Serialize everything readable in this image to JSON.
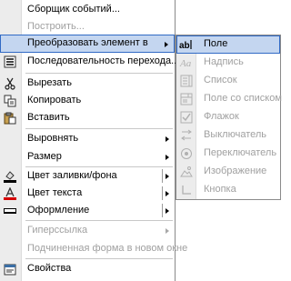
{
  "menu": {
    "items": [
      {
        "label": "Сборщик событий...",
        "icon": "none",
        "disabled": false,
        "submenu": false
      },
      {
        "label": "Построить...",
        "icon": "none",
        "disabled": true,
        "submenu": false
      },
      {
        "label": "Преобразовать элемент в",
        "icon": "none",
        "disabled": false,
        "submenu": true,
        "highlighted": true
      },
      {
        "label": "Последовательность перехода...",
        "icon": "tab-order-icon",
        "disabled": false,
        "submenu": false
      },
      {
        "label": "Вырезать",
        "icon": "scissors-icon",
        "disabled": false,
        "submenu": false
      },
      {
        "label": "Копировать",
        "icon": "copy-icon",
        "disabled": false,
        "submenu": false
      },
      {
        "label": "Вставить",
        "icon": "paste-icon",
        "disabled": false,
        "submenu": false
      },
      {
        "label": "Выровнять",
        "icon": "none",
        "disabled": false,
        "submenu": true
      },
      {
        "label": "Размер",
        "icon": "none",
        "disabled": false,
        "submenu": true
      },
      {
        "label": "Цвет заливки/фона",
        "icon": "fill-color-icon",
        "disabled": false,
        "submenu": true
      },
      {
        "label": "Цвет текста",
        "icon": "font-color-icon",
        "disabled": false,
        "submenu": true
      },
      {
        "label": "Оформление",
        "icon": "special-effect-icon",
        "disabled": false,
        "submenu": true
      },
      {
        "label": "Гиперссылка",
        "icon": "none",
        "disabled": true,
        "submenu": true
      },
      {
        "label": "Подчиненная форма в новом окне",
        "icon": "none",
        "disabled": true,
        "submenu": false
      },
      {
        "label": "Свойства",
        "icon": "properties-icon",
        "disabled": false,
        "submenu": false
      }
    ]
  },
  "submenu": {
    "items": [
      {
        "label": "Поле",
        "icon": "textbox-icon",
        "disabled": false,
        "highlighted": true
      },
      {
        "label": "Надпись",
        "icon": "label-icon",
        "disabled": true
      },
      {
        "label": "Список",
        "icon": "listbox-icon",
        "disabled": true
      },
      {
        "label": "Поле со списком",
        "icon": "combobox-icon",
        "disabled": true
      },
      {
        "label": "Флажок",
        "icon": "checkbox-icon",
        "disabled": true
      },
      {
        "label": "Выключатель",
        "icon": "toggle-button-icon",
        "disabled": true
      },
      {
        "label": "Переключатель",
        "icon": "option-button-icon",
        "disabled": true
      },
      {
        "label": "Изображение",
        "icon": "image-icon",
        "disabled": true
      },
      {
        "label": "Кнопка",
        "icon": "command-button-icon",
        "disabled": true
      }
    ]
  },
  "colors": {
    "highlight_bg": "#c4d6f0",
    "highlight_border": "#316ac5",
    "disabled_text": "#a0a0a0",
    "fill_color_swatch": "#000000",
    "font_color_swatch": "#d40000"
  }
}
